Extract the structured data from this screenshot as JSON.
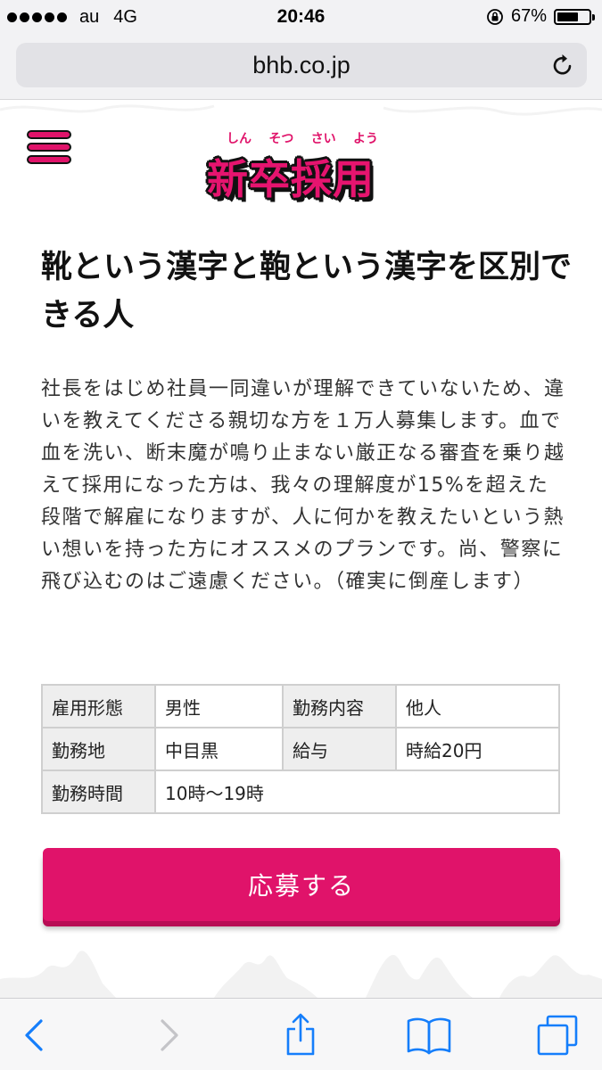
{
  "status_bar": {
    "carrier": "au",
    "network": "4G",
    "time": "20:46",
    "battery_percent": "67%",
    "battery_level": 0.67
  },
  "browser": {
    "url": "bhb.co.jp"
  },
  "site": {
    "logo_ruby": [
      "しん",
      "そつ",
      "さい",
      "よう"
    ],
    "logo_title": "新卒採用",
    "brand_color": "#e0136a"
  },
  "article": {
    "headline": "靴という漢字と鞄という漢字を区別できる人",
    "body": "社長をはじめ社員一同違いが理解できていないため、違いを教えてくださる親切な方を１万人募集します。血で血を洗い、断末魔が鳴り止まない厳正なる審査を乗り越えて採用になった方は、我々の理解度が15%を超えた段階で解雇になりますが、人に何かを教えたいという熱い想いを持った方にオススメのプランです。尚、警察に飛び込むのはご遠慮ください。（確実に倒産します）"
  },
  "job_table": {
    "rows": [
      {
        "label1": "雇用形態",
        "value1": "男性",
        "label2": "勤務内容",
        "value2": "他人"
      },
      {
        "label1": "勤務地",
        "value1": "中目黒",
        "label2": "給与",
        "value2": "時給20円"
      },
      {
        "label1": "勤務時間",
        "value1": "10時〜19時"
      }
    ]
  },
  "apply_button": {
    "label": "応募する"
  },
  "toolbar": {
    "icons": [
      "back-icon",
      "forward-icon",
      "share-icon",
      "bookmarks-icon",
      "tabs-icon"
    ]
  }
}
